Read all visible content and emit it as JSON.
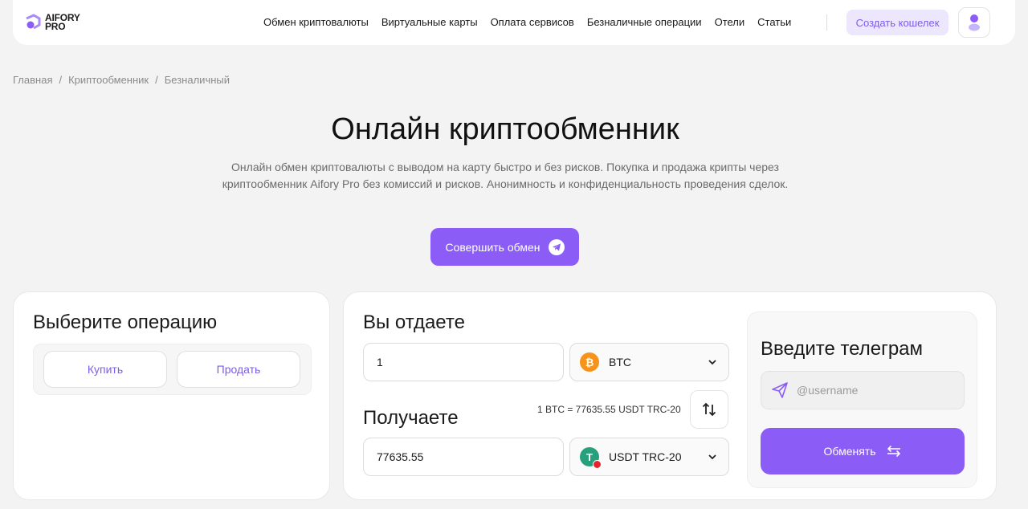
{
  "header": {
    "logo_line1": "AIFORY",
    "logo_line2": "PRO",
    "nav": [
      "Обмен криптовалюты",
      "Виртуальные карты",
      "Оплата сервисов",
      "Безналичные операции",
      "Отели",
      "Статьи"
    ],
    "create_wallet": "Создать кошелек",
    "avatar_icon": "user-icon"
  },
  "breadcrumb": [
    "Главная",
    "Криптообменник",
    "Безналичный"
  ],
  "breadcrumb_sep": "/",
  "hero": {
    "title": "Онлайн криптообменник",
    "subtitle": "Онлайн обмен криптовалюты с выводом на карту быстро и без рисков. Покупка и продажа крипты через криптообменник Aifory Pro без комиссий и рисков. Анонимность и конфиденциальность проведения сделок.",
    "cta": "Совершить обмен",
    "cta_icon": "telegram-icon"
  },
  "operation": {
    "title": "Выберите операцию",
    "buy": "Купить",
    "sell": "Продать"
  },
  "exchange": {
    "give_label": "Вы отдаете",
    "give_value": "1",
    "give_currency": "BTC",
    "get_label": "Получаете",
    "get_value": "77635.55",
    "get_currency": "USDT TRC-20",
    "rate": "1 BTC = 77635.55 USDT TRC-20"
  },
  "telegram": {
    "title": "Введите телеграм",
    "placeholder": "@username",
    "submit": "Обменять"
  },
  "colors": {
    "accent": "#8b5cf6",
    "accent_light": "#ece7fd",
    "btc": "#f7931a",
    "usdt": "#26a17b",
    "tron": "#e5242c"
  }
}
